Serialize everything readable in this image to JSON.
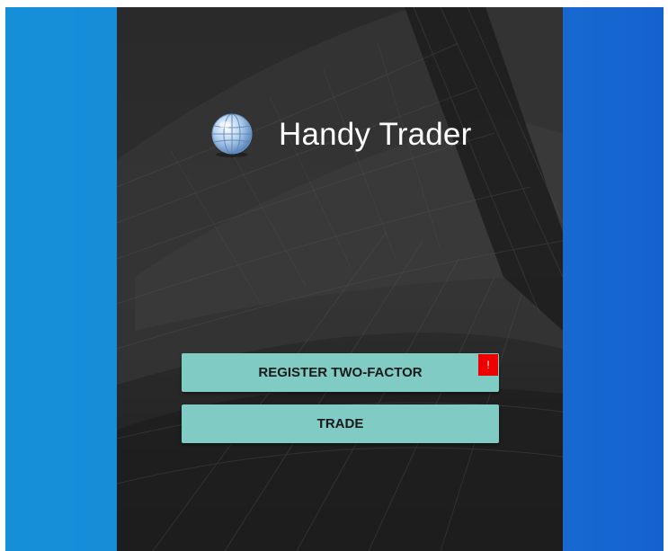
{
  "app": {
    "title": "Handy Trader",
    "logo_icon": "globe-icon"
  },
  "buttons": {
    "register_label": "REGISTER TWO-FACTOR",
    "register_badge": "!",
    "trade_label": "TRADE"
  },
  "colors": {
    "desktop_background": "#1a86d6",
    "app_background": "#232323",
    "button_fill": "#80cbc4",
    "badge_fill": "#ee0000",
    "title_text": "#ffffff"
  }
}
